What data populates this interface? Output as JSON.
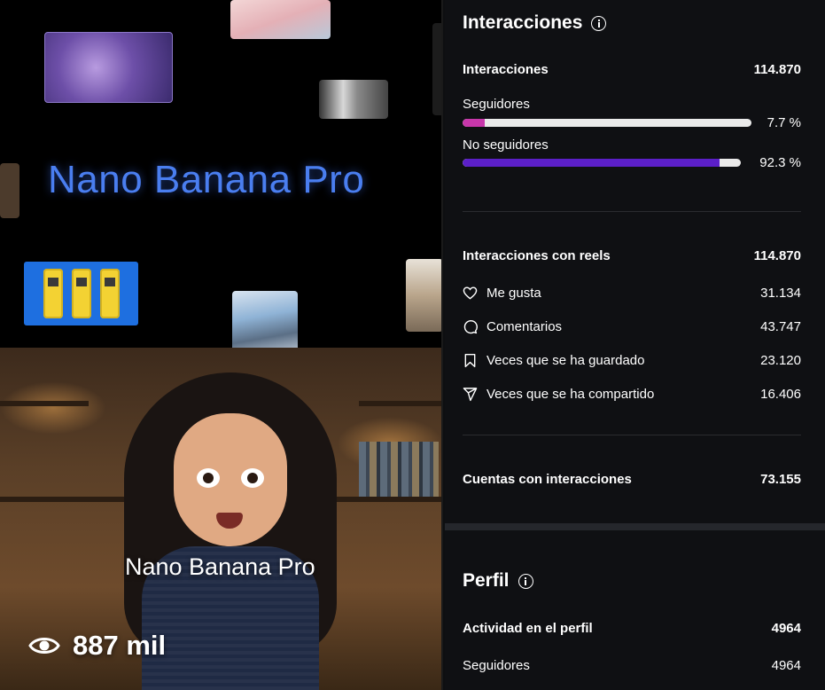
{
  "video": {
    "brand_title": "Nano Banana Pro",
    "overlay_title": "Nano Banana Pro",
    "views": "887 mil"
  },
  "interactions": {
    "heading": "Interacciones",
    "total_label": "Interacciones",
    "total_value": "114.870",
    "followers_label": "Seguidores",
    "followers_pct": "7.7 %",
    "followers_fraction": 0.077,
    "followers_color": "#c837ab",
    "nonfollowers_label": "No seguidores",
    "nonfollowers_pct": "92.3 %",
    "nonfollowers_fraction": 0.923,
    "nonfollowers_color": "#5b1fc8"
  },
  "reels": {
    "label": "Interacciones con reels",
    "value": "114.870",
    "items": [
      {
        "icon": "heart-icon",
        "label": "Me gusta",
        "value": "31.134"
      },
      {
        "icon": "comment-icon",
        "label": "Comentarios",
        "value": "43.747"
      },
      {
        "icon": "bookmark-icon",
        "label": "Veces que se ha guardado",
        "value": "23.120"
      },
      {
        "icon": "send-icon",
        "label": "Veces que se ha compartido",
        "value": "16.406"
      }
    ]
  },
  "accounts": {
    "label": "Cuentas con interacciones",
    "value": "73.155"
  },
  "profile": {
    "heading": "Perfil",
    "activity_label": "Actividad en el perfil",
    "activity_value": "4964",
    "followers_label": "Seguidores",
    "followers_value": "4964"
  }
}
